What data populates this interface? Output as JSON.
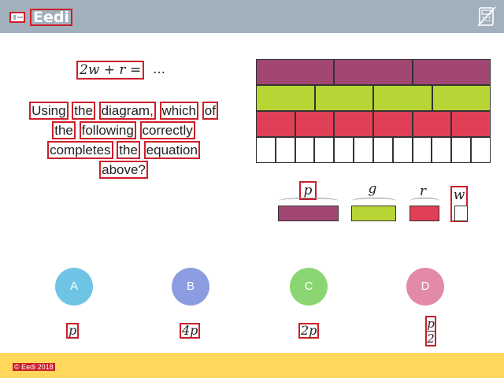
{
  "header": {
    "brand": "Eedi",
    "logo_icon": "eedi-logo-icon",
    "calculator_icon": "calculator-disabled-icon",
    "background": "#a2b0be"
  },
  "question": {
    "equation": "2w + r =",
    "ellipsis": "…",
    "words": [
      "Using",
      "the",
      "diagram,",
      "which",
      "of",
      "the",
      "following",
      "correctly",
      "completes",
      "the",
      "equation",
      "above?"
    ]
  },
  "diagram": {
    "rows": [
      {
        "color": "#a24674",
        "parts": 3
      },
      {
        "color": "#b8d536",
        "parts": 4
      },
      {
        "color": "#e04057",
        "parts": 6
      },
      {
        "color": "#ffffff",
        "parts": 12
      }
    ]
  },
  "key": {
    "p": "p",
    "g": "g",
    "r": "r",
    "w": "w"
  },
  "options": [
    {
      "letter": "A",
      "value": "p",
      "color": "#6fc4e5"
    },
    {
      "letter": "B",
      "value": "4p",
      "color": "#8c9ce0"
    },
    {
      "letter": "C",
      "value": "2p",
      "color": "#8bd673"
    },
    {
      "letter": "D",
      "value_numerator": "p",
      "value_denominator": "2",
      "color": "#e38aa8"
    }
  ],
  "footer": {
    "copyright": "© Eedi 2018",
    "background": "#ffd75b"
  }
}
